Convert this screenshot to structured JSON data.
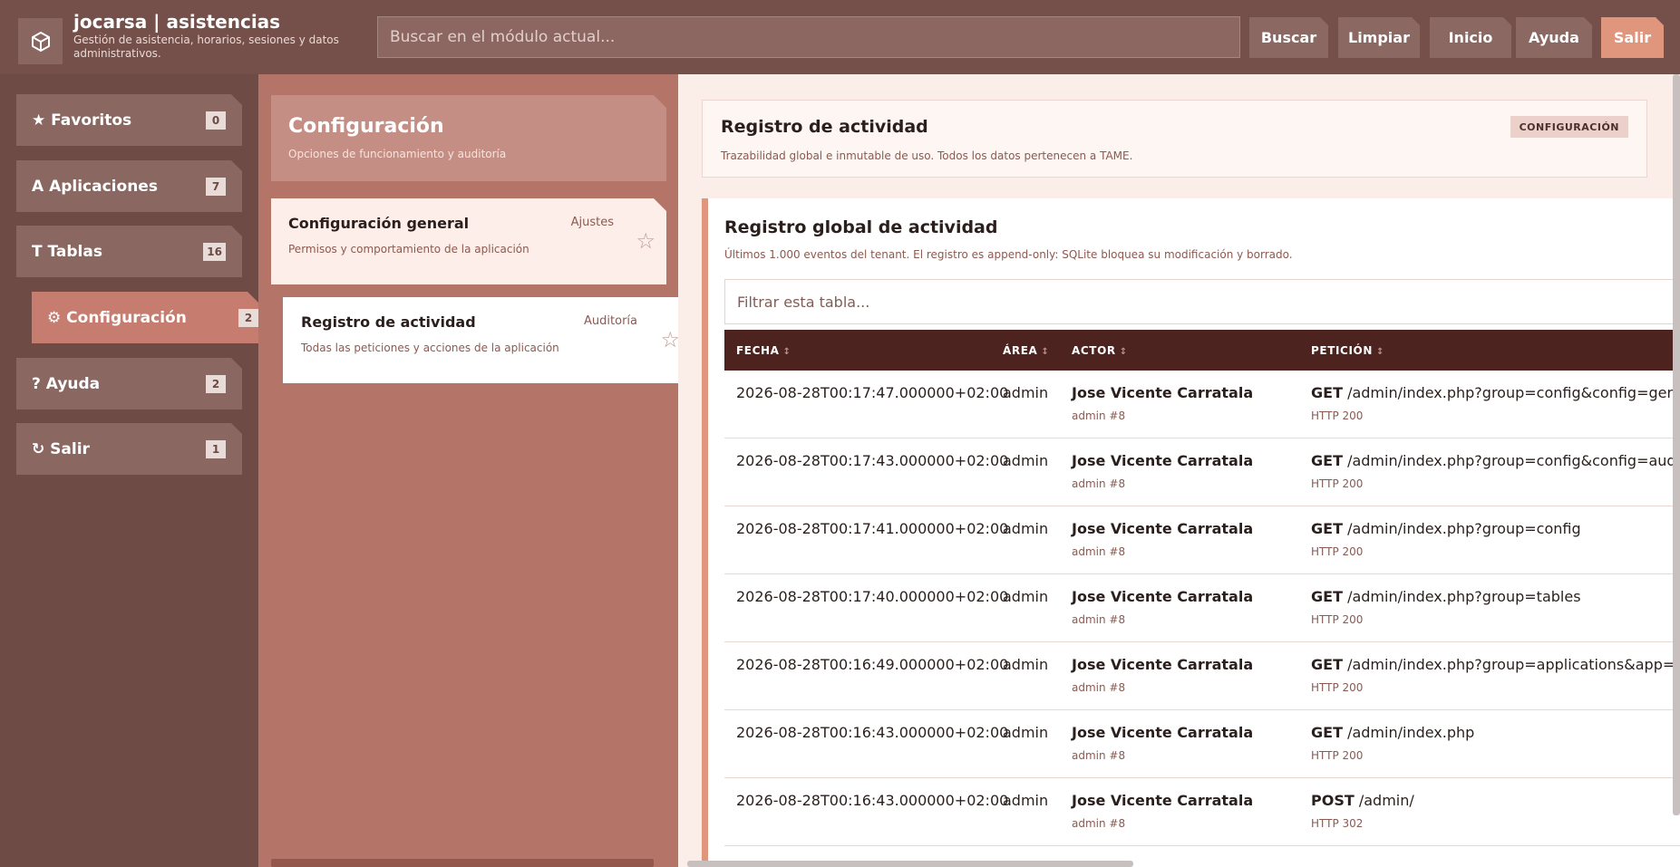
{
  "header": {
    "app_title": "jocarsa | asistencias",
    "app_subtitle": "Gestión de asistencia, horarios, sesiones y datos administrativos.",
    "search_placeholder": "Buscar en el módulo actual...",
    "buttons": {
      "buscar": "Buscar",
      "limpiar": "Limpiar",
      "inicio": "Inicio",
      "ayuda": "Ayuda",
      "salir": "Salir"
    }
  },
  "sidebar": {
    "items": [
      {
        "label": "★ Favoritos",
        "count": "0"
      },
      {
        "label": "A Aplicaciones",
        "count": "7"
      },
      {
        "label": "T Tablas",
        "count": "16"
      },
      {
        "label": "⚙ Configuración",
        "count": "2"
      },
      {
        "label": "? Ayuda",
        "count": "2"
      },
      {
        "label": "↻ Salir",
        "count": "1"
      }
    ]
  },
  "middle": {
    "title": "Configuración",
    "subtitle": "Opciones de funcionamiento y auditoría",
    "cards": [
      {
        "title": "Configuración general",
        "tag": "Ajustes",
        "desc": "Permisos y comportamiento de la aplicación"
      },
      {
        "title": "Registro de actividad",
        "tag": "Auditoría",
        "desc": "Todas las peticiones y acciones de la aplicación"
      }
    ]
  },
  "main": {
    "info": {
      "title": "Registro de actividad",
      "subtitle": "Trazabilidad global e inmutable de uso. Todos los datos pertenecen a TAME.",
      "badge": "CONFIGURACIÓN"
    },
    "panel": {
      "title": "Registro global de actividad",
      "subtitle": "Últimos 1.000 eventos del tenant. El registro es append-only: SQLite bloquea su modificación y borrado.",
      "filter_placeholder": "Filtrar esta tabla..."
    },
    "table": {
      "columns": [
        "FECHA",
        "ÁREA",
        "ACTOR",
        "PETICIÓN"
      ],
      "sort_glyph": "↕",
      "rows": [
        {
          "date": "2026-08-28T00:17:47.000000+02:00",
          "area": "admin",
          "actor": "Jose Vicente Carratala",
          "actor_sub": "admin #8",
          "method": "GET",
          "path": "/admin/index.php?group=config&config=general",
          "status": "HTTP 200"
        },
        {
          "date": "2026-08-28T00:17:43.000000+02:00",
          "area": "admin",
          "actor": "Jose Vicente Carratala",
          "actor_sub": "admin #8",
          "method": "GET",
          "path": "/admin/index.php?group=config&config=audit",
          "status": "HTTP 200"
        },
        {
          "date": "2026-08-28T00:17:41.000000+02:00",
          "area": "admin",
          "actor": "Jose Vicente Carratala",
          "actor_sub": "admin #8",
          "method": "GET",
          "path": "/admin/index.php?group=config",
          "status": "HTTP 200"
        },
        {
          "date": "2026-08-28T00:17:40.000000+02:00",
          "area": "admin",
          "actor": "Jose Vicente Carratala",
          "actor_sub": "admin #8",
          "method": "GET",
          "path": "/admin/index.php?group=tables",
          "status": "HTTP 200"
        },
        {
          "date": "2026-08-28T00:16:49.000000+02:00",
          "area": "admin",
          "actor": "Jose Vicente Carratala",
          "actor_sub": "admin #8",
          "method": "GET",
          "path": "/admin/index.php?group=applications&app=solici",
          "status": "HTTP 200"
        },
        {
          "date": "2026-08-28T00:16:43.000000+02:00",
          "area": "admin",
          "actor": "Jose Vicente Carratala",
          "actor_sub": "admin #8",
          "method": "GET",
          "path": "/admin/index.php",
          "status": "HTTP 200"
        },
        {
          "date": "2026-08-28T00:16:43.000000+02:00",
          "area": "admin",
          "actor": "Jose Vicente Carratala",
          "actor_sub": "admin #8",
          "method": "POST",
          "path": "/admin/",
          "status": "HTTP 302"
        }
      ]
    }
  },
  "icons": {
    "logo": "cube-icon",
    "card_star": "star-outline-icon"
  },
  "colors": {
    "accent": "#e0957d",
    "table_header": "#4d2320",
    "sidebar_active": "#c67c6e"
  }
}
